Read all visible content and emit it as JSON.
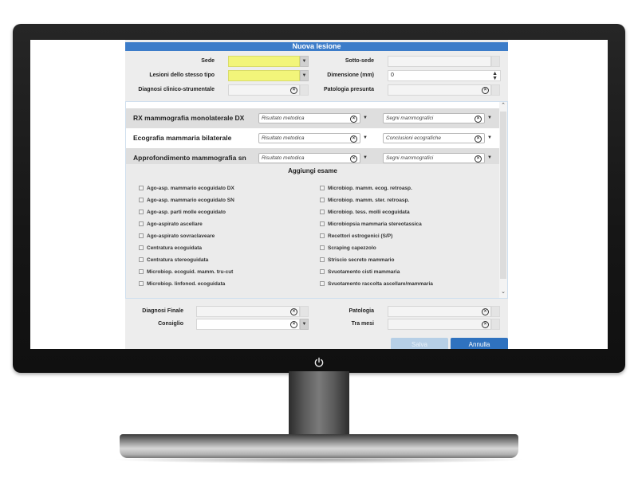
{
  "window": {
    "title": "Nuova lesione"
  },
  "top_form": {
    "sede": {
      "label": "Sede",
      "value": ""
    },
    "sotto_sede": {
      "label": "Sotto-sede",
      "value": ""
    },
    "lesioni": {
      "label": "Lesioni dello stesso tipo",
      "value": ""
    },
    "dimensione": {
      "label": "Dimensione (mm)",
      "value": "0"
    },
    "diagnosi_clinico": {
      "label": "Diagnosi clinico-strumentale",
      "value": ""
    },
    "patologia_presunta": {
      "label": "Patologia presunta",
      "value": ""
    }
  },
  "exams": [
    {
      "name": "RX mammografia monolaterale DX",
      "select1": "Risultato metodica",
      "select2": "Segni mammografici"
    },
    {
      "name": "Ecografia mammaria bilaterale",
      "select1": "Risultato metodica",
      "select2": "Conclusioni ecografiche"
    },
    {
      "name": "Approfondimento mammografia sn",
      "select1": "Risultato metodica",
      "select2": "Segni mammografici"
    }
  ],
  "add_exam": {
    "title": "Aggiungi esame",
    "left_items": [
      "Ago-asp. mammario ecoguidato DX",
      "Ago-asp. mammario ecoguidato SN",
      "Ago-asp. parti molle ecoguidato",
      "Ago-aspirato ascellare",
      "Ago-aspirato sovraclaveare",
      "Centratura ecoguidata",
      "Centratura stereoguidata",
      "Microbiop. ecoguid. mamm. tru-cut",
      "Microbiop. linfonod. ecoguidata"
    ],
    "right_items": [
      "Microbiop. mamm. ecog. retroasp.",
      "Microbiop. mamm. ster. retroasp.",
      "Microbiop. tess. molli ecoguidata",
      "Microbiopsia mammaria stereotassica",
      "Recettori estrogenici (S/P)",
      "Scraping capezzolo",
      "Striscio secreto mammario",
      "Svuotamento cisti mammaria",
      "Svuotamento raccolta ascellare/mammaria"
    ]
  },
  "bottom_form": {
    "diagnosi_finale": {
      "label": "Diagnosi Finale",
      "value": ""
    },
    "patologia": {
      "label": "Patologia",
      "value": ""
    },
    "consiglio": {
      "label": "Consiglio",
      "value": ""
    },
    "tra_mesi": {
      "label": "Tra mesi",
      "value": ""
    }
  },
  "buttons": {
    "save": "Salva",
    "cancel": "Annulla"
  },
  "icons": {
    "clear": "clear-circle-icon",
    "dropdown": "caret-down-icon",
    "spinner": "spinner-icon",
    "power": "power-icon",
    "scroll_up": "chevron-up-icon",
    "scroll_down": "chevron-down-icon"
  },
  "colors": {
    "accent": "#2f72bf",
    "title_bar": "#3c7cc9",
    "required_field": "#f2f57a",
    "disabled_button": "#b6cfe6"
  }
}
